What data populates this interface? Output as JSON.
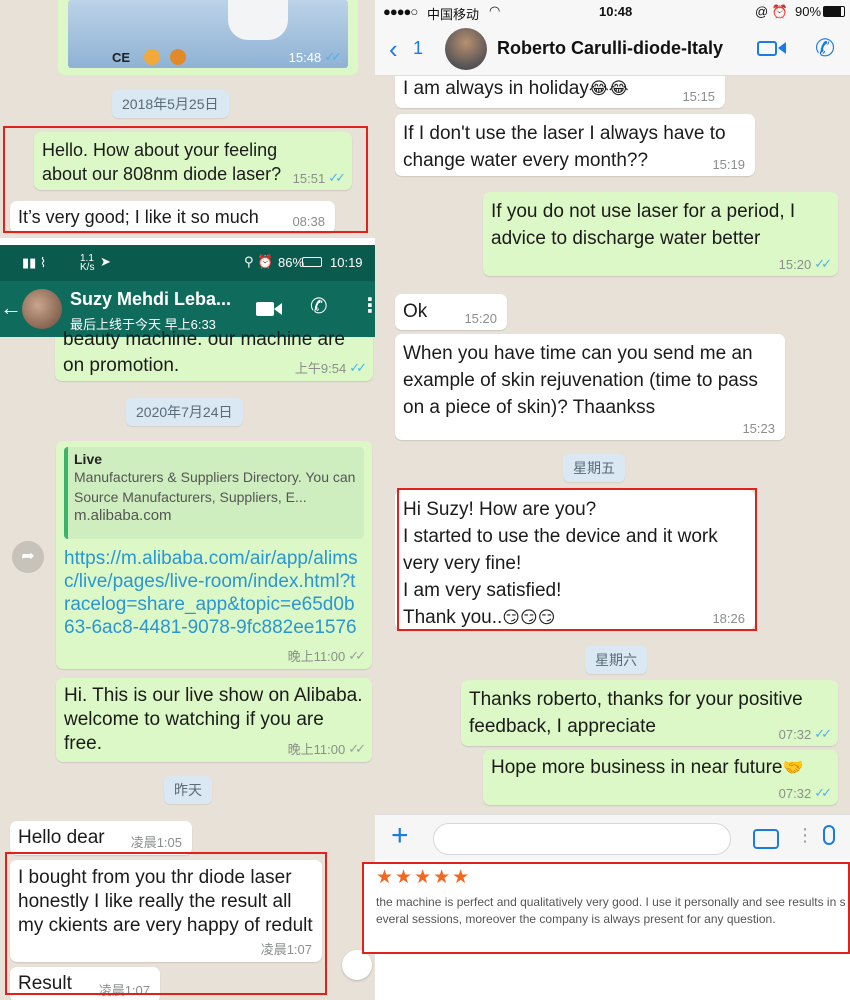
{
  "topleft": {
    "time": "15:48",
    "date_chip": "2018年5月25日",
    "msg1": "Hello. How about your feeling about our 808nm diode laser?",
    "msg1_time": "15:51",
    "msg2": "It’s very good; I like it so much",
    "msg2_time": "08:38"
  },
  "android": {
    "status_left": "1.1 K/s",
    "status_battery": "86%",
    "status_time": "10:19",
    "contact_name": "Suzy Mehdi Leba...",
    "last_seen": "最后上线于今天 早上6:33",
    "msg_promo": "beauty machine. our machine are on promotion.",
    "msg_promo_time": "上午9:54",
    "date_chip": "2020年7月24日",
    "link_title": "Live",
    "link_desc": "Manufacturers & Suppliers Directory. You can Source Manufacturers, Suppliers, E...",
    "link_domain": "m.alibaba.com",
    "link_url": "https://m.alibaba.com/air/app/alimsc/live/pages/live-room/index.html?tracelog=share_app&topic=e65d0b63-6ac8-4481-9078-9fc882ee1576",
    "link_time": "晚上11:00",
    "msg_live": "Hi.  This is our live show on Alibaba.  welcome to watching if you are free.",
    "msg_live_time": "晚上11:00",
    "date_chip2": "昨天",
    "msg_hello": "Hello dear",
    "msg_hello_time": "凌晨1:05",
    "msg_bought": "I bought from you thr diode laser honestly I like really the result all my ckients are very happy of redult",
    "msg_bought_time": "凌晨1:07",
    "msg_result": "Result",
    "msg_result_time": "凌晨1:07"
  },
  "ios": {
    "carrier": "中国移动",
    "time": "10:48",
    "battery": "90%",
    "back_count": "1",
    "contact_name": "Roberto Carulli-diode-Italy",
    "msg_holiday": "I am always in holiday",
    "msg_holiday_time": "15:15",
    "msg_water": "If I don't use the laser I always have to change water every month??",
    "msg_water_time": "15:19",
    "msg_advice": "If you do not use laser for a period, I advice to discharge water better",
    "msg_advice_time": "15:20",
    "msg_ok": "Ok",
    "msg_ok_time": "15:20",
    "msg_skin": "When you have time can you send me an example of skin rejuvenation (time to pass on a piece of skin)?  Thaankss",
    "msg_skin_time": "15:23",
    "date_fri": "星期五",
    "msg_suzy": "Hi Suzy!  How are you?\nI started to use the device and it work very very fine!\nI am very satisfied!\nThank you..",
    "msg_suzy_time": "18:26",
    "date_sat": "星期六",
    "msg_thanks": "Thanks roberto, thanks for your positive feedback, I appreciate",
    "msg_thanks_time": "07:32",
    "msg_hope": "Hope more business in near future",
    "msg_hope_time": "07:32"
  },
  "review": {
    "stars": "★★★★★",
    "text": "the machine is perfect and qualitatively very good.  I use it personally and see results in several sessions, moreover the company is always present for any question."
  },
  "colors": {
    "whatsapp_green": "#0f6b5c",
    "bubble_out": "#dcf8c6",
    "highlight_red": "#e3211c",
    "ios_blue": "#1a7be5",
    "star_orange": "#f26722"
  }
}
